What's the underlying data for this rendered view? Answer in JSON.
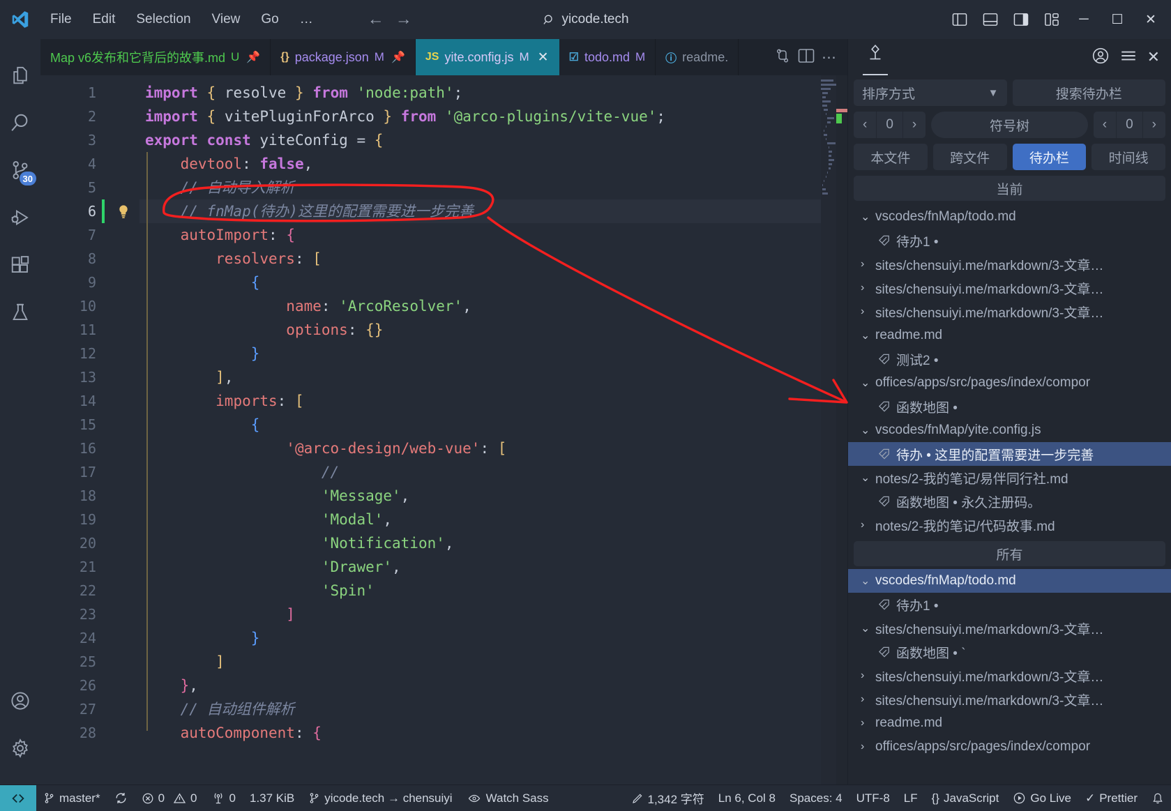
{
  "titlebar": {
    "logo_icon": "vscode-logo-icon",
    "menus": [
      "File",
      "Edit",
      "Selection",
      "View",
      "Go",
      "…"
    ],
    "nav_back_icon": "arrow-left-icon",
    "nav_forward_icon": "arrow-forward-icon",
    "search_icon": "search-icon",
    "search_text": "yicode.tech",
    "layout_icons": [
      "toggle-primary-sidebar-icon",
      "toggle-panel-icon",
      "toggle-secondary-sidebar-icon",
      "customize-layout-icon"
    ],
    "window_minimize": "─",
    "window_maximize": "☐",
    "window_close": "✕"
  },
  "activitybar": {
    "items": [
      {
        "name": "explorer",
        "icon": "files-icon"
      },
      {
        "name": "search",
        "icon": "search-icon"
      },
      {
        "name": "source-control",
        "icon": "source-control-icon",
        "badge": "30"
      },
      {
        "name": "run-and-debug",
        "icon": "run-debug-icon"
      },
      {
        "name": "extensions",
        "icon": "extensions-icon"
      },
      {
        "name": "testing",
        "icon": "beaker-icon"
      }
    ],
    "bottom": [
      {
        "name": "accounts",
        "icon": "account-icon"
      },
      {
        "name": "manage",
        "icon": "gear-icon"
      }
    ]
  },
  "tabs": [
    {
      "label": "Map v6发布和它背后的故事.md",
      "badge": "U",
      "icon": "markdown-file-icon",
      "pinned": true,
      "active": false,
      "color": "#4ec94e"
    },
    {
      "label": "package.json",
      "badge": "M",
      "icon": "{}",
      "pinned": true,
      "active": false,
      "color": "#a68cf0"
    },
    {
      "label": "yite.config.js",
      "badge": "M",
      "icon": "JS",
      "pinned": false,
      "active": true,
      "color": "#d7c9f7"
    },
    {
      "label": "todo.md",
      "badge": "M",
      "icon": "checkbox-icon",
      "pinned": false,
      "active": false,
      "color": "#a68cf0"
    },
    {
      "label": "readme.",
      "badge": "",
      "icon": "info-icon",
      "pinned": false,
      "active": false,
      "color": "#8a93a3"
    }
  ],
  "tab_actions": [
    "compare-changes-icon",
    "split-editor-icon",
    "more-actions-icon"
  ],
  "editor": {
    "cursor_line": 6,
    "lines": [
      {
        "n": 1,
        "tokens": [
          [
            "kw",
            "import"
          ],
          [
            "plain",
            " "
          ],
          [
            "brc",
            "{"
          ],
          [
            "plain",
            " resolve "
          ],
          [
            "brc",
            "}"
          ],
          [
            "plain",
            " "
          ],
          [
            "kw",
            "from"
          ],
          [
            "plain",
            " "
          ],
          [
            "str",
            "'node:path'"
          ],
          [
            "plain",
            ";"
          ]
        ]
      },
      {
        "n": 2,
        "tokens": [
          [
            "kw",
            "import"
          ],
          [
            "plain",
            " "
          ],
          [
            "brc",
            "{"
          ],
          [
            "plain",
            " vitePluginForArco "
          ],
          [
            "brc",
            "}"
          ],
          [
            "plain",
            " "
          ],
          [
            "kw",
            "from"
          ],
          [
            "plain",
            " "
          ],
          [
            "str",
            "'@arco-plugins/vite-vue'"
          ],
          [
            "plain",
            ";"
          ]
        ]
      },
      {
        "n": 3,
        "tokens": [
          [
            "kw",
            "export"
          ],
          [
            "plain",
            " "
          ],
          [
            "kw",
            "const"
          ],
          [
            "plain",
            " yiteConfig = "
          ],
          [
            "brc",
            "{"
          ]
        ]
      },
      {
        "n": 4,
        "tokens": [
          [
            "plain",
            "    "
          ],
          [
            "prop",
            "devtool"
          ],
          [
            "plain",
            ": "
          ],
          [
            "kw",
            "false"
          ],
          [
            "plain",
            ","
          ]
        ]
      },
      {
        "n": 5,
        "tokens": [
          [
            "plain",
            "    "
          ],
          [
            "cmt",
            "// 自动导入解析"
          ]
        ]
      },
      {
        "n": 6,
        "tokens": [
          [
            "plain",
            "    "
          ],
          [
            "cmt",
            "// fnMap(待办)这里的配置需要进一步完善"
          ]
        ]
      },
      {
        "n": 7,
        "tokens": [
          [
            "plain",
            "    "
          ],
          [
            "prop",
            "autoImport"
          ],
          [
            "plain",
            ": "
          ],
          [
            "brc3",
            "{"
          ]
        ]
      },
      {
        "n": 8,
        "tokens": [
          [
            "plain",
            "        "
          ],
          [
            "prop",
            "resolvers"
          ],
          [
            "plain",
            ": "
          ],
          [
            "brc",
            "["
          ]
        ]
      },
      {
        "n": 9,
        "tokens": [
          [
            "plain",
            "            "
          ],
          [
            "brc2",
            "{"
          ]
        ]
      },
      {
        "n": 10,
        "tokens": [
          [
            "plain",
            "                "
          ],
          [
            "prop",
            "name"
          ],
          [
            "plain",
            ": "
          ],
          [
            "str",
            "'ArcoResolver'"
          ],
          [
            "plain",
            ","
          ]
        ]
      },
      {
        "n": 11,
        "tokens": [
          [
            "plain",
            "                "
          ],
          [
            "prop",
            "options"
          ],
          [
            "plain",
            ": "
          ],
          [
            "brc",
            "{}"
          ]
        ]
      },
      {
        "n": 12,
        "tokens": [
          [
            "plain",
            "            "
          ],
          [
            "brc2",
            "}"
          ]
        ]
      },
      {
        "n": 13,
        "tokens": [
          [
            "plain",
            "        "
          ],
          [
            "brc",
            "]"
          ],
          [
            "plain",
            ","
          ]
        ]
      },
      {
        "n": 14,
        "tokens": [
          [
            "plain",
            "        "
          ],
          [
            "prop",
            "imports"
          ],
          [
            "plain",
            ": "
          ],
          [
            "brc",
            "["
          ]
        ]
      },
      {
        "n": 15,
        "tokens": [
          [
            "plain",
            "            "
          ],
          [
            "brc2",
            "{"
          ]
        ]
      },
      {
        "n": 16,
        "tokens": [
          [
            "plain",
            "                "
          ],
          [
            "prop",
            "'@arco-design/web-vue'"
          ],
          [
            "plain",
            ": "
          ],
          [
            "brc",
            "["
          ]
        ]
      },
      {
        "n": 17,
        "tokens": [
          [
            "plain",
            "                    "
          ],
          [
            "cmt",
            "//"
          ]
        ]
      },
      {
        "n": 18,
        "tokens": [
          [
            "plain",
            "                    "
          ],
          [
            "str",
            "'Message'"
          ],
          [
            "plain",
            ","
          ]
        ]
      },
      {
        "n": 19,
        "tokens": [
          [
            "plain",
            "                    "
          ],
          [
            "str",
            "'Modal'"
          ],
          [
            "plain",
            ","
          ]
        ]
      },
      {
        "n": 20,
        "tokens": [
          [
            "plain",
            "                    "
          ],
          [
            "str",
            "'Notification'"
          ],
          [
            "plain",
            ","
          ]
        ]
      },
      {
        "n": 21,
        "tokens": [
          [
            "plain",
            "                    "
          ],
          [
            "str",
            "'Drawer'"
          ],
          [
            "plain",
            ","
          ]
        ]
      },
      {
        "n": 22,
        "tokens": [
          [
            "plain",
            "                    "
          ],
          [
            "str",
            "'Spin'"
          ]
        ]
      },
      {
        "n": 23,
        "tokens": [
          [
            "plain",
            "                "
          ],
          [
            "mag",
            "]"
          ]
        ]
      },
      {
        "n": 24,
        "tokens": [
          [
            "plain",
            "            "
          ],
          [
            "brc2",
            "}"
          ]
        ]
      },
      {
        "n": 25,
        "tokens": [
          [
            "plain",
            "        "
          ],
          [
            "brc",
            "]"
          ]
        ]
      },
      {
        "n": 26,
        "tokens": [
          [
            "plain",
            "    "
          ],
          [
            "brc3",
            "}"
          ],
          [
            "plain",
            ","
          ]
        ]
      },
      {
        "n": 27,
        "tokens": [
          [
            "plain",
            "    "
          ],
          [
            "cmt",
            "// 自动组件解析"
          ]
        ]
      },
      {
        "n": 28,
        "tokens": [
          [
            "plain",
            "    "
          ],
          [
            "prop",
            "autoComponent"
          ],
          [
            "plain",
            ": "
          ],
          [
            "brc3",
            "{"
          ]
        ]
      }
    ],
    "lightbulb_icon": "lightbulb-icon"
  },
  "sidebar": {
    "tab_icon": "fnmap-pin-icon",
    "header_right_icons": [
      "account-icon",
      "menu-icon",
      "close-icon"
    ],
    "sort_label": "排序方式",
    "sort_chevron": "chevron-down-icon",
    "search_placeholder": "搜索待办栏",
    "nav_left_1": "‹",
    "nav_count_1": "0",
    "nav_right_1": "›",
    "symbol_tree_label": "符号树",
    "nav_left_2": "‹",
    "nav_count_2": "0",
    "nav_right_2": "›",
    "filters": [
      {
        "label": "本文件",
        "selected": false
      },
      {
        "label": "跨文件",
        "selected": false
      },
      {
        "label": "待办栏",
        "selected": true
      },
      {
        "label": "时间线",
        "selected": false
      }
    ],
    "group_current_label": "当前",
    "group_all_label": "所有",
    "current_rows": [
      {
        "type": "file",
        "chev": "⌄",
        "label": "vscodes/fnMap/todo.md",
        "selected": false
      },
      {
        "type": "tag",
        "label": "待办1 •",
        "selected": false
      },
      {
        "type": "file",
        "chev": "›",
        "label": "sites/chensuiyi.me/markdown/3-文章…",
        "selected": false
      },
      {
        "type": "file",
        "chev": "›",
        "label": "sites/chensuiyi.me/markdown/3-文章…",
        "selected": false
      },
      {
        "type": "file",
        "chev": "›",
        "label": "sites/chensuiyi.me/markdown/3-文章…",
        "selected": false
      },
      {
        "type": "file",
        "chev": "⌄",
        "label": "readme.md",
        "selected": false
      },
      {
        "type": "tag",
        "label": "测试2 •",
        "selected": false
      },
      {
        "type": "file",
        "chev": "⌄",
        "label": "offices/apps/src/pages/index/compor",
        "selected": false
      },
      {
        "type": "tag",
        "label": "函数地图 •",
        "selected": false
      },
      {
        "type": "file",
        "chev": "⌄",
        "label": "vscodes/fnMap/yite.config.js",
        "selected": false
      },
      {
        "type": "tag",
        "label": "待办 • 这里的配置需要进一步完善",
        "selected": true
      },
      {
        "type": "file",
        "chev": "⌄",
        "label": "notes/2-我的笔记/易伴同行社.md",
        "selected": false
      },
      {
        "type": "tag",
        "label": "函数地图 • 永久注册码。",
        "selected": false
      },
      {
        "type": "file",
        "chev": "›",
        "label": "notes/2-我的笔记/代码故事.md",
        "selected": false
      }
    ],
    "all_rows": [
      {
        "type": "file",
        "chev": "⌄",
        "label": "vscodes/fnMap/todo.md",
        "selected": true
      },
      {
        "type": "tag",
        "label": "待办1 •",
        "selected": false
      },
      {
        "type": "file",
        "chev": "⌄",
        "label": "sites/chensuiyi.me/markdown/3-文章…",
        "selected": false
      },
      {
        "type": "tag",
        "label": "函数地图 • `",
        "selected": false
      },
      {
        "type": "file",
        "chev": "›",
        "label": "sites/chensuiyi.me/markdown/3-文章…",
        "selected": false
      },
      {
        "type": "file",
        "chev": "›",
        "label": "sites/chensuiyi.me/markdown/3-文章…",
        "selected": false
      },
      {
        "type": "file",
        "chev": "›",
        "label": "readme.md",
        "selected": false
      },
      {
        "type": "file",
        "chev": "›",
        "label": "offices/apps/src/pages/index/compor",
        "selected": false
      }
    ]
  },
  "statusbar": {
    "remote_icon": "remote-window-icon",
    "left": [
      {
        "icon": "source-control-icon",
        "text": "master*",
        "name": "branch"
      },
      {
        "icon": "sync-icon",
        "text": "",
        "name": "sync"
      },
      {
        "icon": "error-icon",
        "text": "0",
        "name": "errors"
      },
      {
        "icon": "warning-icon",
        "text": "0",
        "name": "warnings"
      },
      {
        "icon": "radio-tower-icon",
        "text": "0",
        "name": "ports"
      },
      {
        "icon": "",
        "text": "1.37 KiB",
        "name": "file-size"
      },
      {
        "icon": "source-control-icon",
        "text": "yicode.tech → chensuiyi",
        "name": "remote-repo"
      },
      {
        "icon": "eye-icon",
        "text": "Watch Sass",
        "name": "watch-sass"
      }
    ],
    "right": [
      {
        "icon": "pencil-icon",
        "text": "1,342 字符",
        "name": "char-count"
      },
      {
        "icon": "",
        "text": "Ln 6, Col 8",
        "name": "cursor-position"
      },
      {
        "icon": "",
        "text": "Spaces: 4",
        "name": "indentation"
      },
      {
        "icon": "",
        "text": "UTF-8",
        "name": "encoding"
      },
      {
        "icon": "",
        "text": "LF",
        "name": "eol"
      },
      {
        "icon": "{}",
        "text": "JavaScript",
        "name": "language-mode"
      },
      {
        "icon": "play-circle-icon",
        "text": "Go Live",
        "name": "go-live"
      },
      {
        "icon": "check-icon",
        "text": "Prettier",
        "name": "prettier"
      },
      {
        "icon": "bell-icon",
        "text": "",
        "name": "notifications"
      }
    ]
  },
  "annotation": {
    "color": "#f41f1f",
    "shapes": [
      "ellipse-around-line-6-comment",
      "arrow-to-selected-todo-row"
    ]
  }
}
